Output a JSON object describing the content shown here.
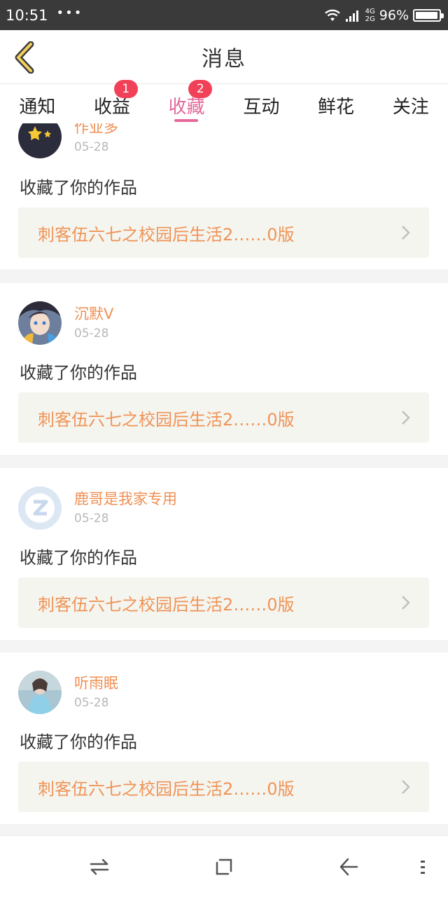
{
  "status_bar": {
    "time": "10:51",
    "dots": "•••",
    "network_top": "4G",
    "network_bottom": "2G",
    "battery_text": "96%",
    "battery_level": 0.96
  },
  "header": {
    "title": "消息"
  },
  "tabs": [
    {
      "label": "通知",
      "badge": ""
    },
    {
      "label": "收益",
      "badge": "1"
    },
    {
      "label": "收藏",
      "badge": "2",
      "active": true
    },
    {
      "label": "互动",
      "badge": ""
    },
    {
      "label": "鲜花",
      "badge": ""
    },
    {
      "label": "关注",
      "badge": ""
    }
  ],
  "notifications": [
    {
      "username": "作业多",
      "date": "05-28",
      "action": "收藏了你的作品",
      "work_title": "刺客伍六七之校园后生活2……0版",
      "avatar_icon": "star-avatar-icon"
    },
    {
      "username": "沉默V",
      "date": "05-28",
      "action": "收藏了你的作品",
      "work_title": "刺客伍六七之校园后生活2……0版",
      "avatar_icon": "anime-avatar-icon"
    },
    {
      "username": "鹿哥是我家专用",
      "date": "05-28",
      "action": "收藏了你的作品",
      "work_title": "刺客伍六七之校园后生活2……0版",
      "avatar_icon": "z-logo-avatar-icon"
    },
    {
      "username": "听雨眠",
      "date": "05-28",
      "action": "收藏了你的作品",
      "work_title": "刺客伍六七之校园后生活2……0版",
      "avatar_icon": "photo-avatar-icon"
    }
  ],
  "colors": {
    "accent": "#e5689b",
    "badge": "#f04158",
    "username": "#ef8f53",
    "work_title": "#ef9457"
  }
}
